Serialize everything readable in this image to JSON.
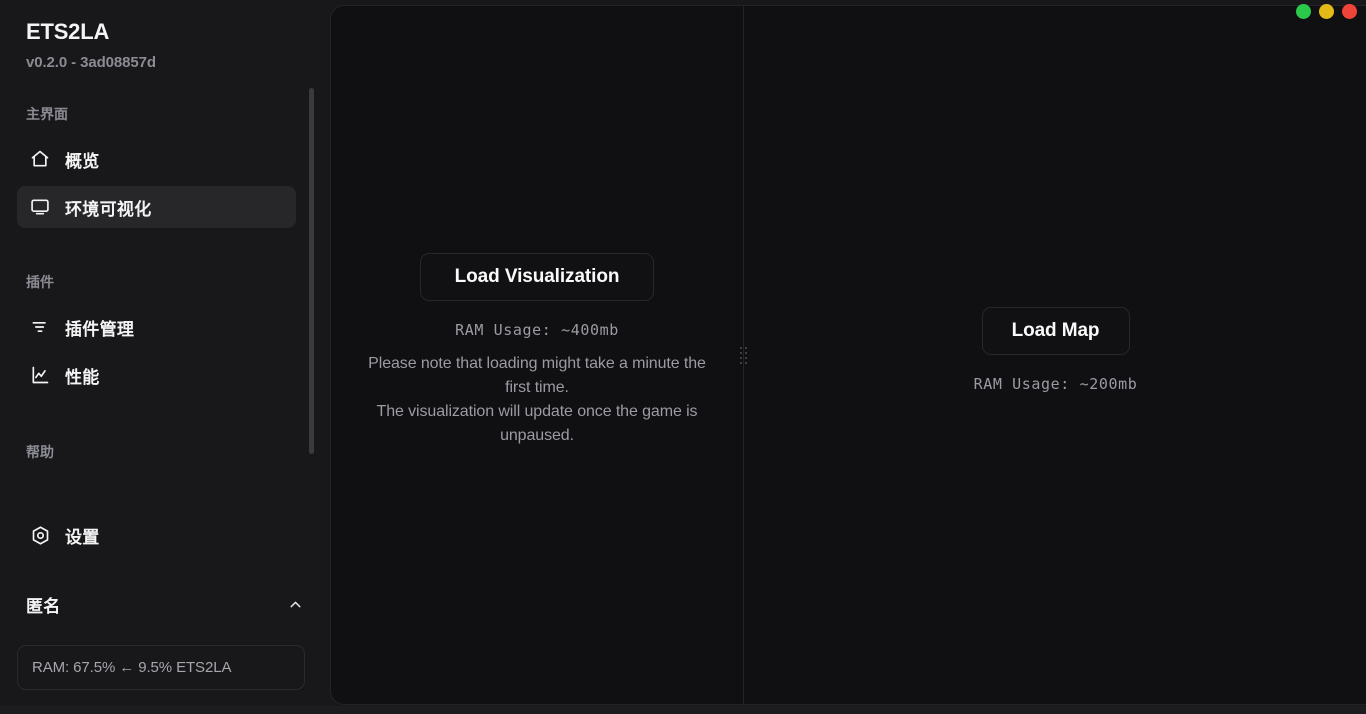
{
  "app": {
    "title": "ETS2LA",
    "version": "v0.2.0 - 3ad08857d"
  },
  "window_controls": {
    "minimize_label": "minimize",
    "maximize_label": "maximize",
    "close_label": "close",
    "colors": {
      "green": "#2bc94b",
      "yellow": "#e4bb16",
      "red": "#f04438"
    }
  },
  "sidebar": {
    "groups": [
      {
        "label": "主界面",
        "items": [
          {
            "label": "概览",
            "icon": "home-icon",
            "active": false
          },
          {
            "label": "环境可视化",
            "icon": "monitor-icon",
            "active": true
          }
        ]
      },
      {
        "label": "插件",
        "items": [
          {
            "label": "插件管理",
            "icon": "sliders-icon",
            "active": false
          },
          {
            "label": "性能",
            "icon": "chart-line-icon",
            "active": false
          }
        ]
      },
      {
        "label": "帮助",
        "items": [
          {
            "label": "设置",
            "icon": "settings-hex-icon",
            "active": false
          }
        ]
      }
    ],
    "collapsible": {
      "label": "匿名",
      "chevron": "chevron-up-icon",
      "expanded": true
    },
    "ram_badge": {
      "text": "RAM: 67.5% ← 9.5% ETS2LA"
    }
  },
  "main": {
    "left_pane": {
      "button_label": "Load Visualization",
      "ram_usage": "RAM Usage: ~400mb",
      "note_lines": [
        "Please note that loading might take a minute the",
        "first time.",
        "The visualization will update once the game is",
        "unpaused."
      ]
    },
    "right_pane": {
      "button_label": "Load Map",
      "ram_usage": "RAM Usage: ~200mb"
    },
    "divider": {
      "grip_label": "resize-handle"
    }
  }
}
